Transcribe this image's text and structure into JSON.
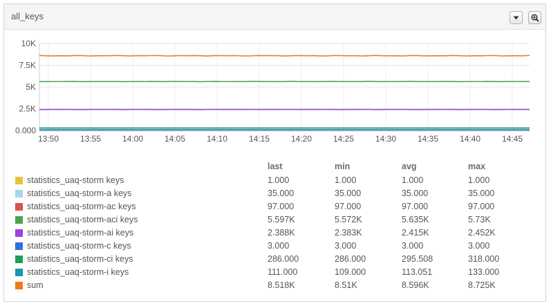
{
  "panel": {
    "title": "all_keys"
  },
  "icons": {
    "dropdown": "caret-down-icon",
    "zoom": "magnifier-zoom-icon"
  },
  "chart_data": {
    "type": "line",
    "x": [
      "13:50",
      "13:55",
      "14:00",
      "14:05",
      "14:10",
      "14:15",
      "14:20",
      "14:25",
      "14:30",
      "14:35",
      "14:40",
      "14:45"
    ],
    "y_ticks": [
      "10K",
      "7.5K",
      "5K",
      "2.5K",
      "0.000"
    ],
    "ylim": [
      0,
      10000
    ],
    "grid": true,
    "series": [
      {
        "name": "statistics_uaq-storm keys",
        "color": "#e8c23a",
        "last": "1.000",
        "min": "1.000",
        "avg": "1.000",
        "max": "1.000",
        "level": 1
      },
      {
        "name": "statistics_uaq-storm-a keys",
        "color": "#a9d3ef",
        "last": "35.000",
        "min": "35.000",
        "avg": "35.000",
        "max": "35.000",
        "level": 35
      },
      {
        "name": "statistics_uaq-storm-ac keys",
        "color": "#d9534f",
        "last": "97.000",
        "min": "97.000",
        "avg": "97.000",
        "max": "97.000",
        "level": 97
      },
      {
        "name": "statistics_uaq-storm-aci keys",
        "color": "#4fa34f",
        "last": "5.597K",
        "min": "5.572K",
        "avg": "5.635K",
        "max": "5.73K",
        "level": 5635
      },
      {
        "name": "statistics_uaq-storm-ai keys",
        "color": "#9b42e0",
        "last": "2.388K",
        "min": "2.383K",
        "avg": "2.415K",
        "max": "2.452K",
        "level": 2415
      },
      {
        "name": "statistics_uaq-storm-c keys",
        "color": "#2f6fe0",
        "last": "3.000",
        "min": "3.000",
        "avg": "3.000",
        "max": "3.000",
        "level": 3
      },
      {
        "name": "statistics_uaq-storm-ci keys",
        "color": "#1f9e5a",
        "last": "286.000",
        "min": "286.000",
        "avg": "295.508",
        "max": "318.000",
        "level": 295
      },
      {
        "name": "statistics_uaq-storm-i keys",
        "color": "#1a96b0",
        "last": "111.000",
        "min": "109.000",
        "avg": "113.051",
        "max": "133.000",
        "level": 113
      },
      {
        "name": "sum",
        "color": "#f07a1a",
        "last": "8.518K",
        "min": "8.51K",
        "avg": "8.596K",
        "max": "8.725K",
        "level": 8596
      }
    ]
  },
  "legend": {
    "columns": [
      "last",
      "min",
      "avg",
      "max"
    ]
  }
}
